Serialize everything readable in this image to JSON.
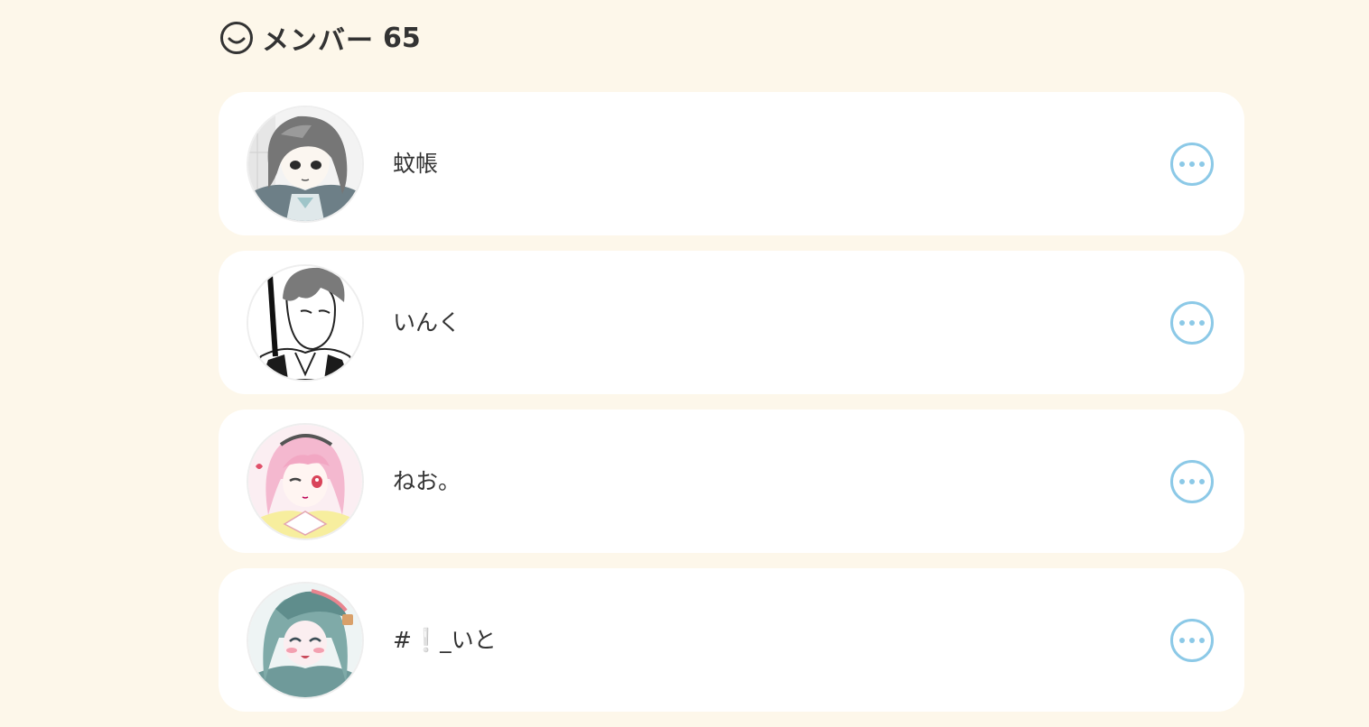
{
  "header": {
    "icon": "smiley-face-icon",
    "title": "メンバー",
    "count": "65"
  },
  "members": [
    {
      "name": "蚊帳",
      "avatar": "avatar-gray-haired-character",
      "more_icon": "ellipsis-icon"
    },
    {
      "name": "いんく",
      "avatar": "avatar-monochrome-suited-character",
      "more_icon": "ellipsis-icon"
    },
    {
      "name": "ねお。",
      "avatar": "avatar-pink-haired-character",
      "more_icon": "ellipsis-icon"
    },
    {
      "name": "#❕_いと",
      "avatar": "avatar-teal-haired-character",
      "more_icon": "ellipsis-icon"
    }
  ],
  "colors": {
    "background": "#fdf7ea",
    "card": "#ffffff",
    "accent": "#8cc9e7",
    "text": "#333333"
  }
}
